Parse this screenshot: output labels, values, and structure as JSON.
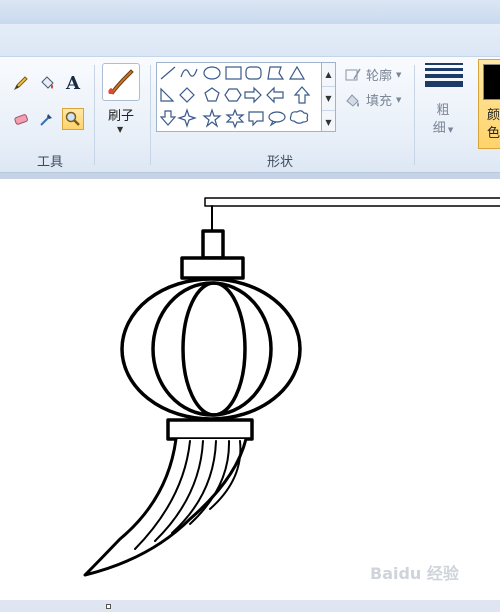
{
  "ribbon": {
    "tools_group": {
      "label": "工具",
      "tools": [
        "pencil-icon",
        "fill-bucket-icon",
        "text-icon",
        "eraser-icon",
        "color-picker-icon",
        "magnifier-icon"
      ],
      "active_tool": "magnifier-icon"
    },
    "brush": {
      "label": "刷子",
      "icon": "brush-icon"
    },
    "shapes_group": {
      "label": "形状",
      "shapes": [
        "line",
        "curve",
        "oval",
        "rectangle",
        "rounded-rectangle",
        "polygon",
        "triangle",
        "right-triangle",
        "diamond",
        "pentagon",
        "hexagon",
        "right-arrow",
        "left-arrow",
        "up-arrow",
        "down-arrow",
        "four-point-star",
        "five-point-star",
        "six-point-star",
        "rounded-callout",
        "oval-callout",
        "cloud-callout"
      ],
      "outline_label": "轮廓",
      "fill_label": "填充"
    },
    "size": {
      "label_line1": "粗",
      "label_line2": "细"
    },
    "color": {
      "label_line1": "颜",
      "label_line2": "色",
      "color1": "#000000"
    }
  },
  "watermark": "Baidu 经验"
}
